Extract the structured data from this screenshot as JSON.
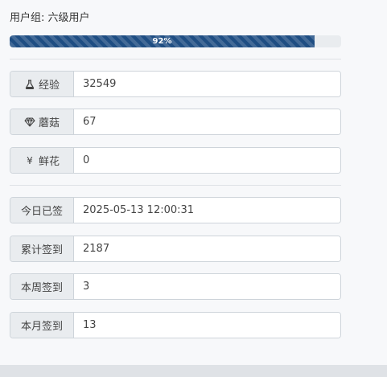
{
  "user_group": {
    "label": "用户组: 六级用户"
  },
  "progress": {
    "percent": 92,
    "label": "92%"
  },
  "stats": [
    {
      "icon": "flask-icon",
      "label": "经验",
      "value": "32549"
    },
    {
      "icon": "diamond-icon",
      "label": "蘑菇",
      "value": "67"
    },
    {
      "icon": "yen-icon",
      "icon_glyph": "¥",
      "label": "鲜花",
      "value": "0"
    }
  ],
  "checkin": [
    {
      "label": "今日已签",
      "value": "2025-05-13 12:00:31"
    },
    {
      "label": "累计签到",
      "value": "2187"
    },
    {
      "label": "本周签到",
      "value": "3"
    },
    {
      "label": "本月签到",
      "value": "13"
    }
  ]
}
